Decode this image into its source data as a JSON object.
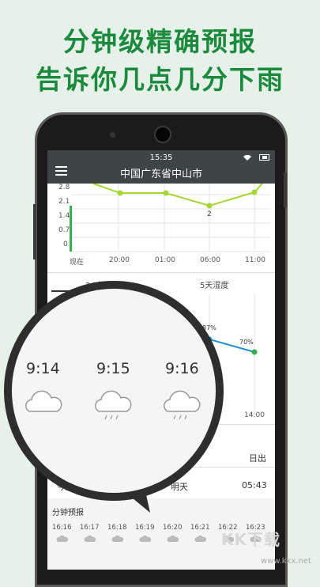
{
  "promo": {
    "line1": "分钟级精确预报",
    "line2": "告诉你几点几分下雨"
  },
  "status": {
    "time": "15:35"
  },
  "header": {
    "location": "中国广东省中山市"
  },
  "rain_chart": {
    "yticks": [
      "2.8",
      "2.1",
      "1.4",
      "0.7",
      "0"
    ],
    "xticks": [
      "现在",
      "20:00",
      "01:00",
      "06:00",
      "11:00"
    ],
    "point_label": "2"
  },
  "tabs": [
    {
      "label": "24小时湿度"
    },
    {
      "label": "5天湿度"
    }
  ],
  "humidity": {
    "labels": [
      "87%",
      "70%"
    ],
    "end_tick": "14:00"
  },
  "sun": {
    "sunset_label": "日出",
    "today": "今天",
    "tomorrow": "明天",
    "time": "05:43"
  },
  "bubble": {
    "times": [
      "9:14",
      "9:15",
      "9:16"
    ]
  },
  "minute_forecast": {
    "title": "分钟预报",
    "times": [
      "16:16",
      "16:17",
      "16:18",
      "16:19",
      "16:20",
      "16:21",
      "16:22",
      "16:23"
    ]
  },
  "watermark": {
    "text": "KK下载",
    "url": "www.kkx.net"
  },
  "colors": {
    "brand_green": "#1c8a3c",
    "line_green": "#a6d630",
    "humidity_blue": "#1f8fd1"
  }
}
